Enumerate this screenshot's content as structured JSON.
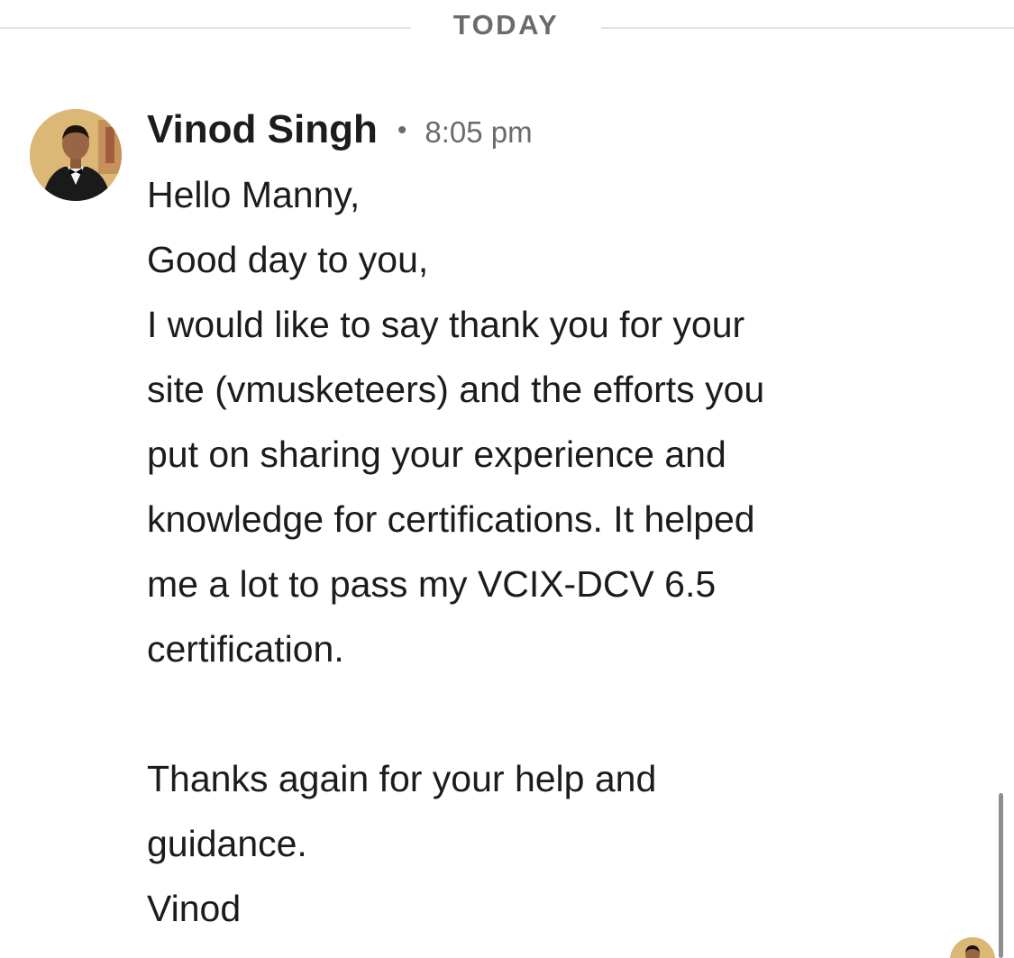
{
  "divider": {
    "label": "TODAY"
  },
  "message": {
    "sender": "Vinod Singh",
    "separator": "•",
    "time": "8:05 pm",
    "avatar_icon": "user-photo-avatar",
    "lines": [
      "Hello Manny,",
      "Good day to you,",
      "I would like to say thank you for your",
      "site (vmusketeers) and the efforts you",
      "put on sharing your experience and",
      "knowledge for certifications. It helped",
      "me a lot to pass my VCIX-DCV 6.5",
      "certification.",
      "",
      "Thanks again for your help and",
      "guidance.",
      "Vinod"
    ]
  },
  "colors": {
    "background": "#ffffff",
    "text_primary": "#1c1c1e",
    "text_secondary": "#6b6b6b",
    "divider": "#e3e3e3",
    "avatar_bg": "#d9b06a"
  }
}
